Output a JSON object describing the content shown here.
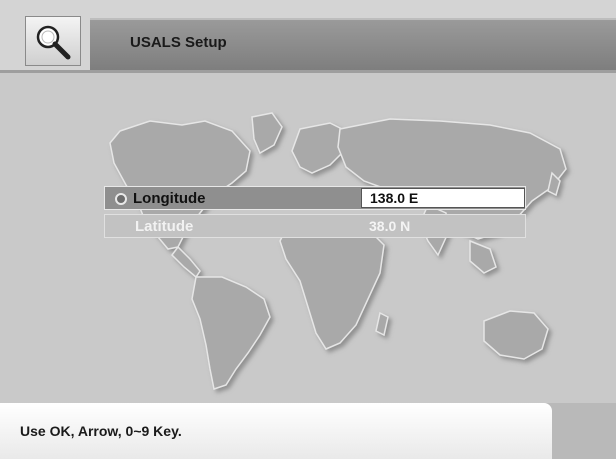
{
  "header": {
    "title": "USALS Setup",
    "icon": "magnifier-icon"
  },
  "fields": {
    "longitude": {
      "label": "Longitude",
      "value": "138.0 E"
    },
    "latitude": {
      "label": "Latitude",
      "value": "38.0 N"
    }
  },
  "help": {
    "text": "Use OK, Arrow, 0~9 Key."
  }
}
